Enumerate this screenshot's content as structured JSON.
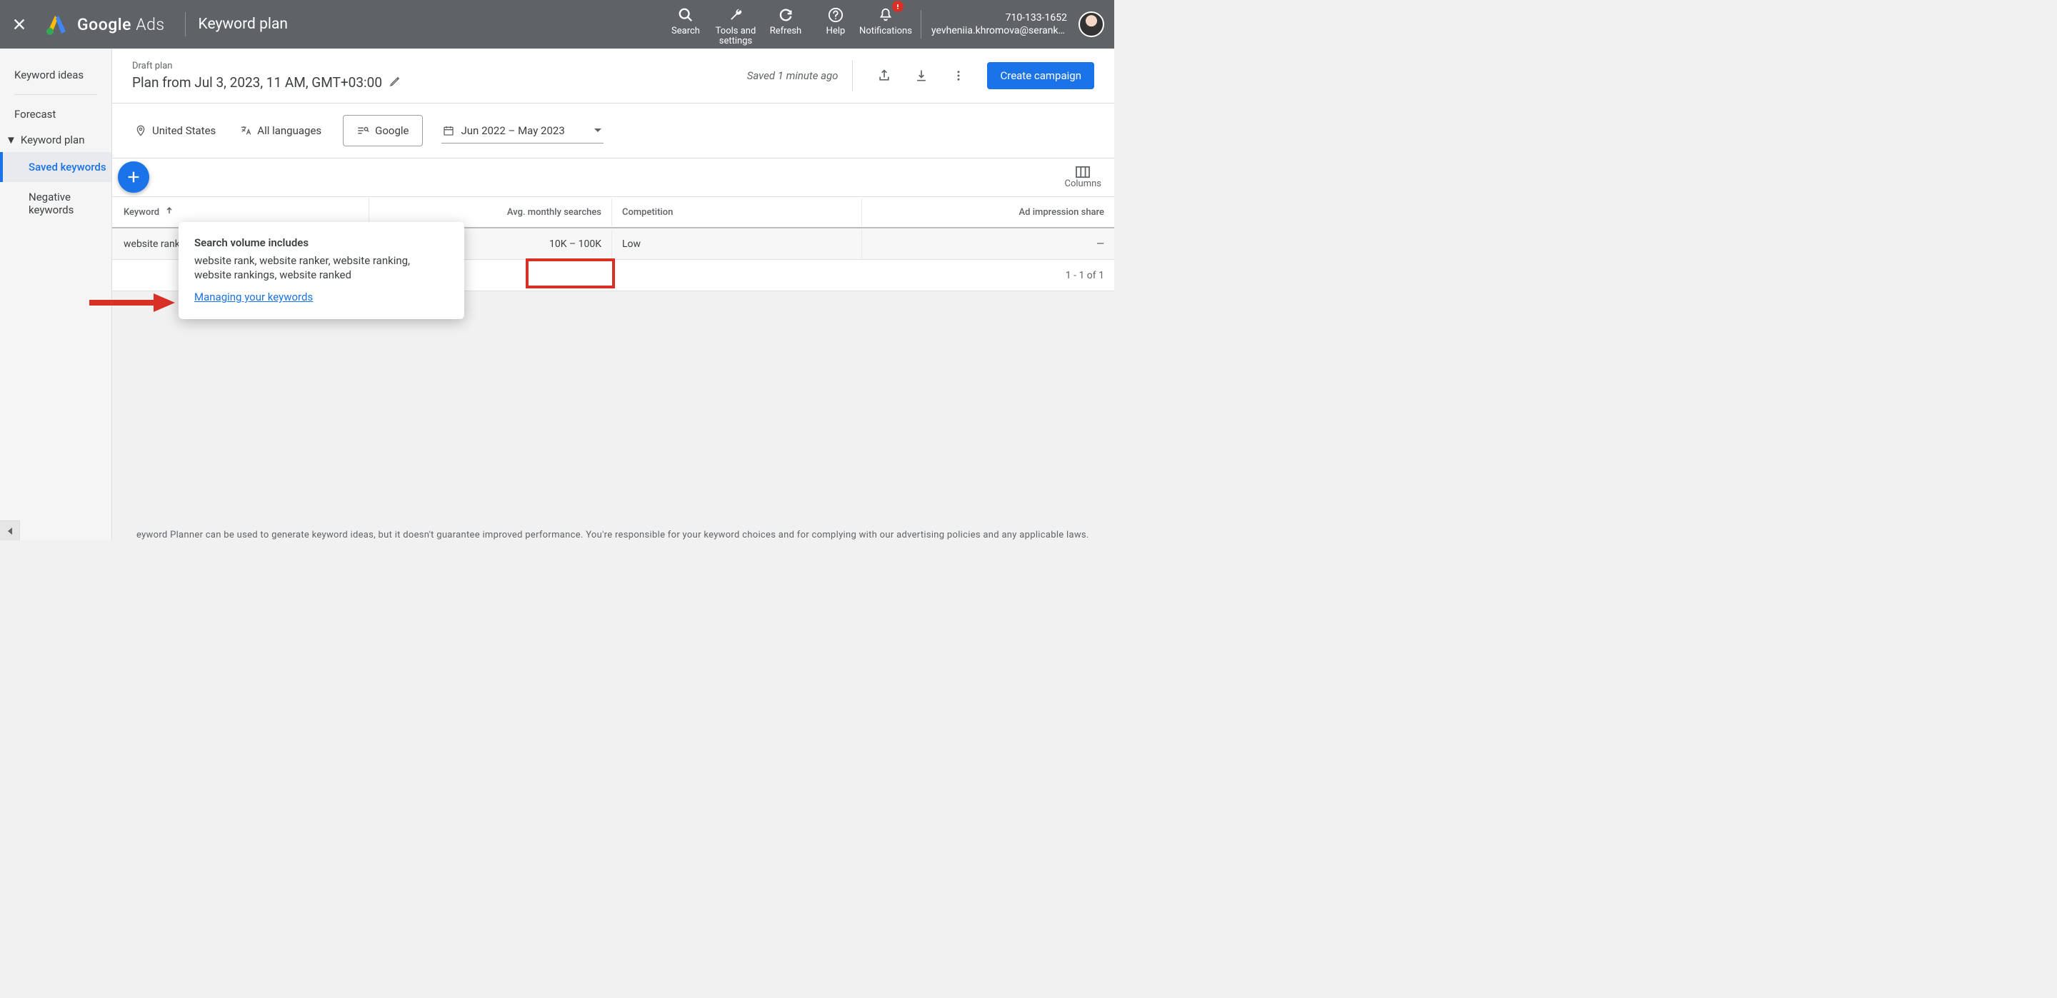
{
  "topbar": {
    "brand_strong": "Google",
    "brand_light": "Ads",
    "section": "Keyword plan",
    "tools": {
      "search": "Search",
      "tools_settings_l1": "Tools and",
      "tools_settings_l2": "settings",
      "refresh": "Refresh",
      "help": "Help",
      "notifications": "Notifications"
    },
    "account_id": "710-133-1652",
    "account_email": "yevheniia.khromova@serankin…"
  },
  "sidebar": {
    "keyword_ideas": "Keyword ideas",
    "forecast": "Forecast",
    "keyword_plan": "Keyword plan",
    "saved_keywords": "Saved keywords",
    "negative_keywords": "Negative keywords"
  },
  "plan": {
    "draft": "Draft plan",
    "title": "Plan from Jul 3, 2023, 11 AM, GMT+03:00",
    "saved": "Saved 1 minute ago",
    "create_btn": "Create campaign"
  },
  "filters": {
    "location": "United States",
    "language": "All languages",
    "network": "Google",
    "date_range": "Jun 2022 – May 2023"
  },
  "columns_btn": "Columns",
  "table": {
    "headers": {
      "keyword": "Keyword",
      "ams": "Avg. monthly searches",
      "competition": "Competition",
      "ais": "Ad impression share"
    },
    "rows": [
      {
        "keyword": "website rank",
        "ams": "10K – 100K",
        "competition": "Low",
        "ais": "—"
      }
    ],
    "footer": "1 - 1 of 1"
  },
  "popover": {
    "title": "Search volume includes",
    "body": "website rank, website ranker, website ranking, website rankings, website ranked",
    "link": "Managing your keywords"
  },
  "bottom_note": "eyword Planner can be used to generate keyword ideas, but it doesn't guarantee improved performance. You're responsible for your keyword choices and for complying with our advertising policies and any applicable laws."
}
